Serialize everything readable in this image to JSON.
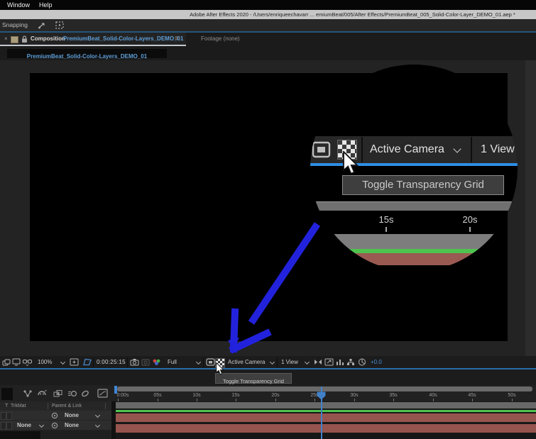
{
  "menubar": {
    "window": "Window",
    "help": "Help"
  },
  "titlebar": {
    "title": "Adobe After Effects 2020 - /Users/enriqueechavarr ... emiumBeat/005/After Effects/PremiumBeat_005_Solid-Color-Layer_DEMO_01.aep *"
  },
  "snapping_bar": {
    "label": "Snapping"
  },
  "panel_tabs": {
    "close_glyph": "×",
    "composition_label": "Composition",
    "composition_name": "PremiumBeat_Solid-Color-Layers_DEMO_01",
    "menu_glyph": "≡",
    "footage_label": "Footage (none)"
  },
  "viewer_tab": {
    "name": "PremiumBeat_Solid-Color-Layers_DEMO_01"
  },
  "magnifier": {
    "view_select": "Active Camera",
    "views_select": "1 View",
    "tooltip": "Toggle Transparency Grid",
    "ruler_labels": [
      "15s",
      "20s"
    ]
  },
  "viewer_toolbar": {
    "zoom_value": "100%",
    "timecode": "0:00:25:15",
    "resolution": "Full",
    "view_select": "Active Camera",
    "views_select": "1 View",
    "exposure": "+0.0"
  },
  "tooltip": {
    "text": "Toggle Transparency Grid"
  },
  "timeline": {
    "ruler_labels": [
      "0:00s",
      "05s",
      "10s",
      "15s",
      "20s",
      "25s",
      "30s",
      "35s",
      "40s",
      "45s",
      "50s"
    ],
    "columns": {
      "t": "T",
      "trkmat": "TrkMat",
      "parent_link": "Parent & Link"
    },
    "rows": [
      {
        "parent_value": "None"
      },
      {
        "trkmat_value": "None",
        "parent_value": "None"
      }
    ]
  },
  "icons": {
    "highlighted_button": "transparency-grid-checkerboard",
    "annotation": "blue-arrow-pointing-to-transparency-grid-button"
  },
  "colors": {
    "accent_blue_text": "#5f9fd8",
    "toolbar_underline": "#2a6da8",
    "magnifier_underline": "#2e8ee4",
    "annotation_arrow": "#2222dd",
    "playhead": "#4080c8",
    "work_area_green": "#4ec34e",
    "layer_bar_red": "#96544e",
    "exposure_blue": "#4a90d9"
  }
}
